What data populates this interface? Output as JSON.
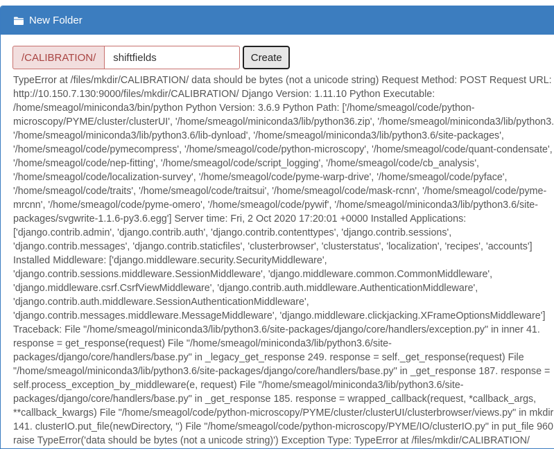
{
  "header": {
    "title": "New Folder",
    "icon": "folder-icon"
  },
  "form": {
    "path_prefix": "/CALIBRATION/",
    "folder_name_value": "shiftfields",
    "create_label": "Create"
  },
  "error": {
    "text": "TypeError at /files/mkdir/CALIBRATION/ data should be bytes (not a unicode string) Request Method: POST Request URL: http://10.150.7.130:9000/files/mkdir/CALIBRATION/ Django Version: 1.11.10 Python Executable: /home/smeagol/miniconda3/bin/python Python Version: 3.6.9 Python Path: ['/home/smeagol/code/python-microscopy/PYME/cluster/clusterUI', '/home/smeagol/miniconda3/lib/python36.zip', '/home/smeagol/miniconda3/lib/python3.6', '/home/smeagol/miniconda3/lib/python3.6/lib-dynload', '/home/smeagol/miniconda3/lib/python3.6/site-packages', '/home/smeagol/code/pymecompress', '/home/smeagol/code/python-microscopy', '/home/smeagol/code/quant-condensate', '/home/smeagol/code/nep-fitting', '/home/smeagol/code/script_logging', '/home/smeagol/code/cb_analysis', '/home/smeagol/code/localization-survey', '/home/smeagol/code/pyme-warp-drive', '/home/smeagol/code/pyface', '/home/smeagol/code/traits', '/home/smeagol/code/traitsui', '/home/smeagol/code/mask-rcnn', '/home/smeagol/code/pyme-mrcnn', '/home/smeagol/code/pyme-omero', '/home/smeagol/code/pywif', '/home/smeagol/miniconda3/lib/python3.6/site-packages/svgwrite-1.1.6-py3.6.egg'] Server time: Fri, 2 Oct 2020 17:20:01 +0000 Installed Applications: ['django.contrib.admin', 'django.contrib.auth', 'django.contrib.contenttypes', 'django.contrib.sessions', 'django.contrib.messages', 'django.contrib.staticfiles', 'clusterbrowser', 'clusterstatus', 'localization', 'recipes', 'accounts'] Installed Middleware: ['django.middleware.security.SecurityMiddleware', 'django.contrib.sessions.middleware.SessionMiddleware', 'django.middleware.common.CommonMiddleware', 'django.middleware.csrf.CsrfViewMiddleware', 'django.contrib.auth.middleware.AuthenticationMiddleware', 'django.contrib.auth.middleware.SessionAuthenticationMiddleware', 'django.contrib.messages.middleware.MessageMiddleware', 'django.middleware.clickjacking.XFrameOptionsMiddleware'] Traceback: File \"/home/smeagol/miniconda3/lib/python3.6/site-packages/django/core/handlers/exception.py\" in inner 41. response = get_response(request) File \"/home/smeagol/miniconda3/lib/python3.6/site-packages/django/core/handlers/base.py\" in _legacy_get_response 249. response = self._get_response(request) File \"/home/smeagol/miniconda3/lib/python3.6/site-packages/django/core/handlers/base.py\" in _get_response 187. response = self.process_exception_by_middleware(e, request) File \"/home/smeagol/miniconda3/lib/python3.6/site-packages/django/core/handlers/base.py\" in _get_response 185. response = wrapped_callback(request, *callback_args, **callback_kwargs) File \"/home/smeagol/code/python-microscopy/PYME/cluster/clusterUI/clusterbrowser/views.py\" in mkdir 141. clusterIO.put_file(newDirectory, '') File \"/home/smeagol/code/python-microscopy/PYME/IO/clusterIO.py\" in put_file 960. raise TypeError('data should be bytes (not a unicode string)') Exception Type: TypeError at /files/mkdir/CALIBRATION/ Exception Value: data should be bytes (not a unicode string)"
  },
  "colors": {
    "header_bg": "#3c7dbf",
    "prefix_bg": "#f2dede",
    "prefix_text": "#a94442",
    "error_text": "#555555"
  }
}
